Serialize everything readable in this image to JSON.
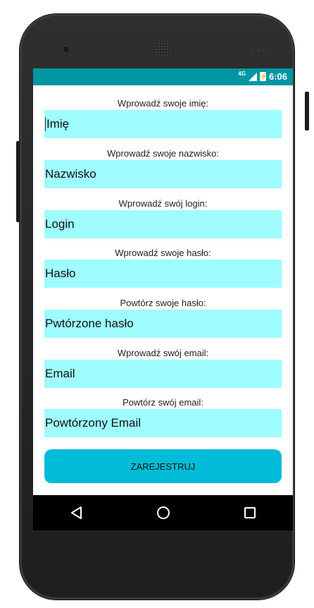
{
  "status_bar": {
    "network": "4G",
    "time": "6:06"
  },
  "form": {
    "fields": [
      {
        "label": "Wprowadź swoje imię:",
        "value": "Imię"
      },
      {
        "label": "Wprowadź swoje nazwisko:",
        "value": "Nazwisko"
      },
      {
        "label": "Wprowadź swój login:",
        "value": "Login"
      },
      {
        "label": "Wprowadź swoje hasło:",
        "value": "Hasło"
      },
      {
        "label": "Powtórz swoje hasło:",
        "value": "Pwtórzone hasło"
      },
      {
        "label": "Wprowadź swój email:",
        "value": "Email"
      },
      {
        "label": "Powtórz swój email:",
        "value": "Powtórzony Email"
      }
    ],
    "submit_label": "ZAREJESTRUJ"
  },
  "colors": {
    "status_bar": "#0096a2",
    "input_bg": "#9ffcff",
    "button_bg": "#00bcd8"
  },
  "icons": {
    "back": "back-triangle-icon",
    "home": "home-circle-icon",
    "recents": "recents-square-icon"
  }
}
